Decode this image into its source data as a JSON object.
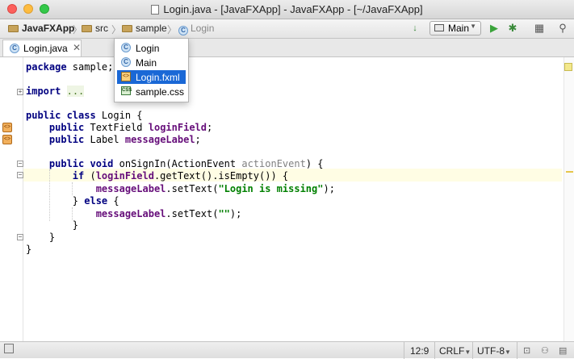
{
  "window": {
    "title": "Login.java - [JavaFXApp] - JavaFXApp - [~/JavaFXApp]"
  },
  "navbar": {
    "breadcrumbs": [
      "JavaFXApp",
      "src",
      "sample",
      "Login"
    ],
    "run_config": "Main"
  },
  "tabs": [
    {
      "label": "Login.java",
      "close": "✕"
    }
  ],
  "popup": {
    "items": [
      {
        "label": "Login",
        "icon": "C"
      },
      {
        "label": "Main",
        "icon": "C"
      },
      {
        "label": "Login.fxml",
        "icon": "<>"
      },
      {
        "label": "sample.css",
        "icon": "CSS"
      }
    ],
    "selected_index": 2
  },
  "code": {
    "l1_kw": "package",
    "l1_rest": " sample;",
    "l3_kw": "import",
    "l3_fold": "...",
    "l5_kw": "public class",
    "l5_rest": " Login {",
    "l6_kw": "public",
    "l6_type": " TextField ",
    "l6_field": "loginField",
    "l6_end": ";",
    "l7_kw": "public",
    "l7_type": " Label ",
    "l7_field": "messageLabel",
    "l7_end": ";",
    "l9_kw": "public void",
    "l9_name": " onSignIn(ActionEvent ",
    "l9_param": "actionEvent",
    "l9_end": ") {",
    "l10_kw": "if",
    "l10_a": " (",
    "l10_field": "loginField",
    "l10_b": ".getText().isEmpty()) {",
    "l11_field": "messageLabel",
    "l11_a": ".setText(",
    "l11_str": "\"Login is missing\"",
    "l11_b": ");",
    "l12_a": "} ",
    "l12_kw": "else",
    "l12_b": " {",
    "l13_field": "messageLabel",
    "l13_a": ".setText(",
    "l13_str": "\"\"",
    "l13_b": ");",
    "l14": "}",
    "l15": "}",
    "l16": "}"
  },
  "status": {
    "position": "12:9",
    "line_sep": "CRLF",
    "encoding": "UTF-8"
  },
  "colors": {
    "keyword": "#000080",
    "field": "#660e7a",
    "string": "#008000",
    "selection": "#1a68d6",
    "caret_row": "#fffde4"
  }
}
